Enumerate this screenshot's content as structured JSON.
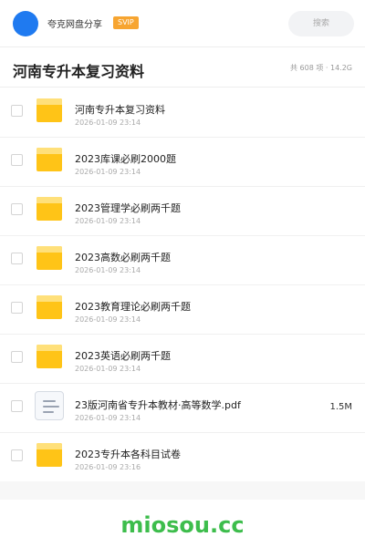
{
  "header": {
    "user_name": "夸克网盘分享",
    "badge": "SVIP",
    "search_placeholder": "搜索"
  },
  "title_row": {
    "title": "河南专升本复习资料",
    "summary": "共 608 项 · 14.2G"
  },
  "files": [
    {
      "name": "河南专升本复习资料",
      "date": "2026-01-09 23:14",
      "type": "folder",
      "size": ""
    },
    {
      "name": "2023库课必刷2000题",
      "date": "2026-01-09 23:14",
      "type": "folder",
      "size": ""
    },
    {
      "name": "2023管理学必刷两千题",
      "date": "2026-01-09 23:14",
      "type": "folder",
      "size": ""
    },
    {
      "name": "2023高数必刷两千题",
      "date": "2026-01-09 23:14",
      "type": "folder",
      "size": ""
    },
    {
      "name": "2023教育理论必刷两千题",
      "date": "2026-01-09 23:14",
      "type": "folder",
      "size": ""
    },
    {
      "name": "2023英语必刷两千题",
      "date": "2026-01-09 23:14",
      "type": "folder",
      "size": ""
    },
    {
      "name": "23版河南省专升本教材·高等数学.pdf",
      "date": "2026-01-09 23:14",
      "type": "document",
      "size": "1.5M"
    },
    {
      "name": "2023专升本各科目试卷",
      "date": "2026-01-09 23:16",
      "type": "folder",
      "size": ""
    }
  ],
  "colors": {
    "avatar": "#1f7af0",
    "svip_badge": "#f7a531",
    "folder": "#ffc417",
    "watermark": "#3dbd4c"
  },
  "watermark": "miosou.cc"
}
